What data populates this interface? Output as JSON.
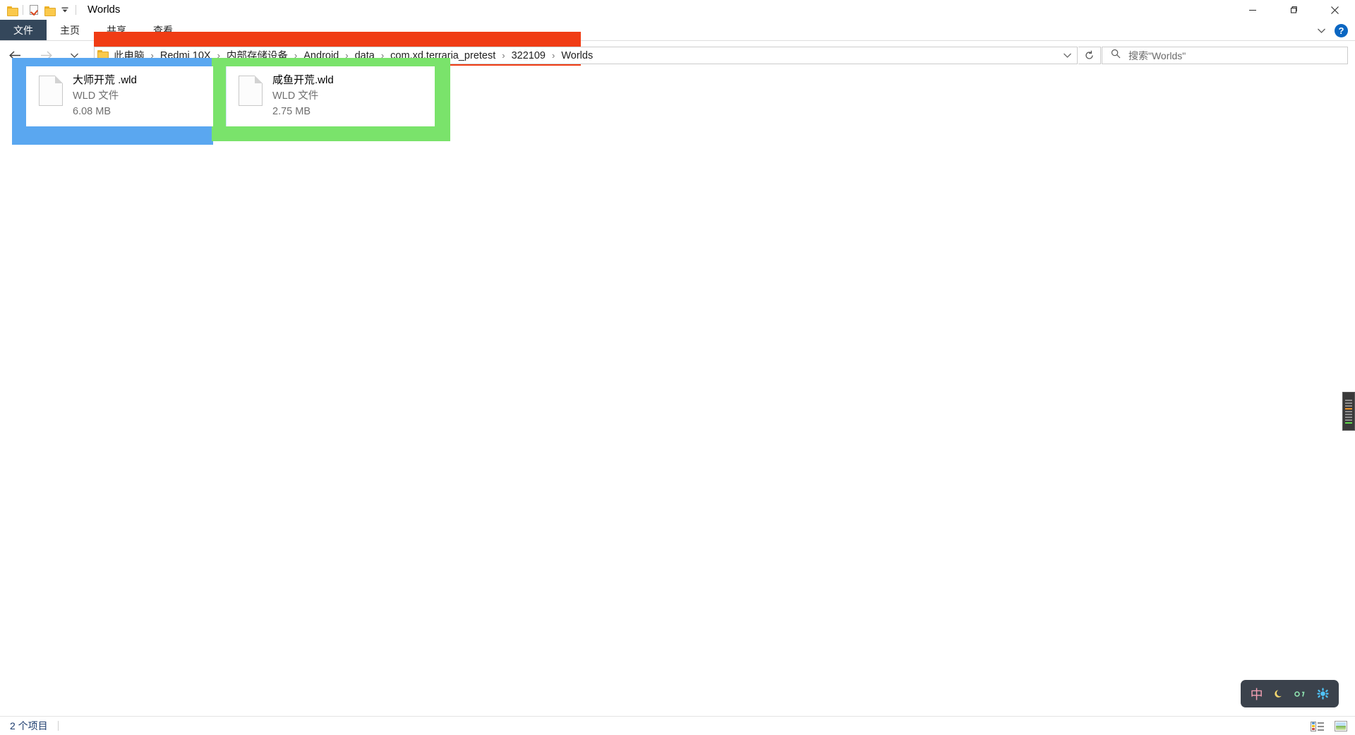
{
  "window": {
    "title": "Worlds",
    "quick_access": [
      {
        "name": "folder-icon",
        "label": ""
      },
      {
        "name": "properties-icon",
        "label": ""
      },
      {
        "name": "new-folder-icon",
        "label": ""
      },
      {
        "name": "customize-qat-caret-icon",
        "label": ""
      }
    ],
    "controls": {
      "minimize": "minimize",
      "maximize": "maximize",
      "close": "close"
    }
  },
  "ribbon": {
    "tabs": [
      {
        "label": "文件",
        "active": true
      },
      {
        "label": "主页",
        "active": false
      },
      {
        "label": "共享",
        "active": false
      },
      {
        "label": "查看",
        "active": false
      }
    ],
    "expand_caret": "chevron-down",
    "help": "?"
  },
  "navbar": {
    "back": "←",
    "forward": "→",
    "recent": "⌄",
    "up": "↑",
    "breadcrumb": [
      "此电脑",
      "Redmi 10X",
      "内部存储设备",
      "Android",
      "data",
      "com.xd.terraria_pretest",
      "322109",
      "Worlds"
    ],
    "separator": "›",
    "dropdown_caret": "⌄",
    "refresh": "↻"
  },
  "search": {
    "placeholder": "搜索\"Worlds\"",
    "value": ""
  },
  "files": [
    {
      "name": "大师开荒 .wld",
      "type": "WLD 文件",
      "size": "6.08 MB",
      "highlight_color": "#5aa7f0"
    },
    {
      "name": "咸鱼开荒.wld",
      "type": "WLD 文件",
      "size": "2.75 MB",
      "highlight_color": "#7ae36b"
    }
  ],
  "annotations": {
    "address_highlight_color": "#f03c14",
    "blue_box_color": "#5aa7f0",
    "green_box_color": "#7ae36b"
  },
  "ime_bar": {
    "items": [
      {
        "name": "chinese-mode-icon",
        "glyph": "中"
      },
      {
        "name": "moon-icon",
        "glyph": "☾"
      },
      {
        "name": "punctuation-icon",
        "glyph": "o,"
      },
      {
        "name": "settings-gear-icon",
        "glyph": "✿"
      }
    ]
  },
  "statusbar": {
    "item_count": "2 个项目",
    "views": [
      {
        "name": "details-view-button"
      },
      {
        "name": "large-icons-view-button"
      }
    ]
  }
}
